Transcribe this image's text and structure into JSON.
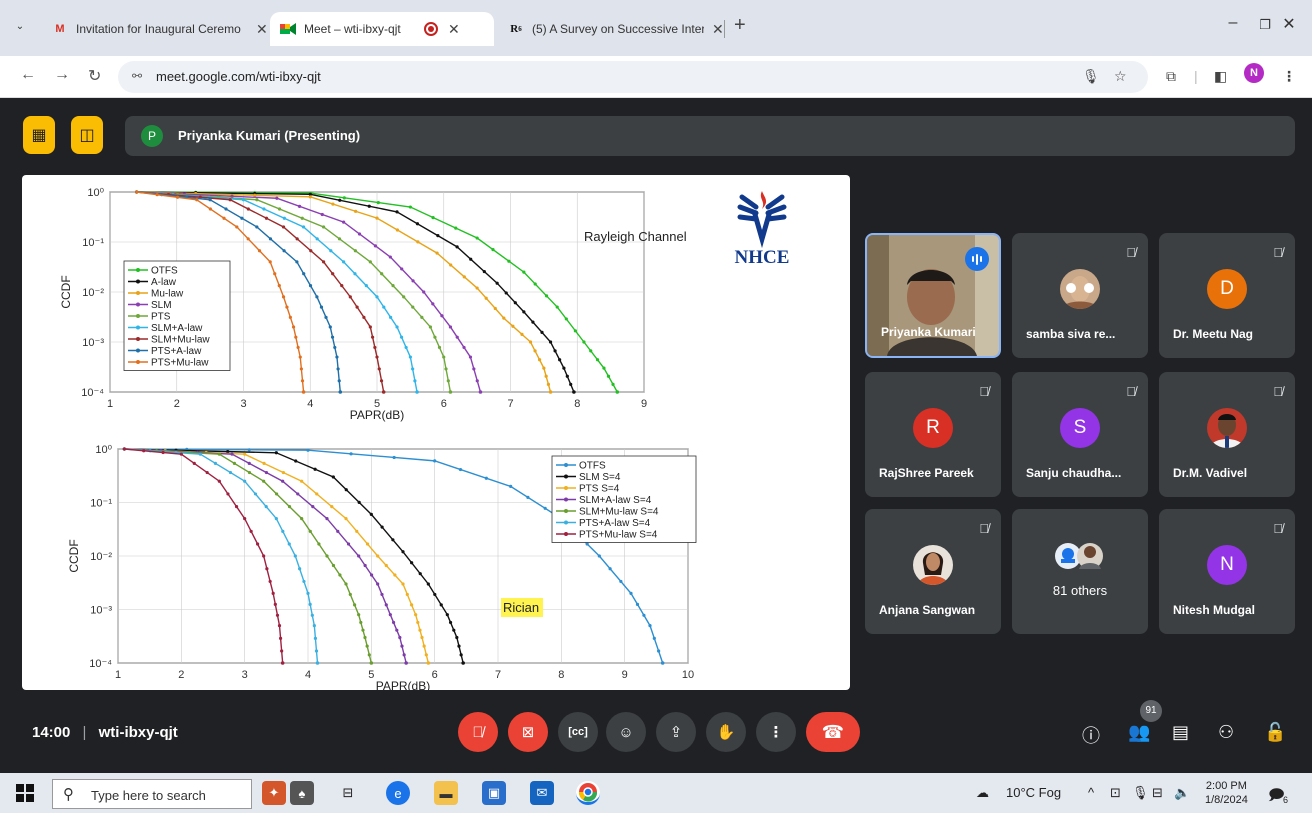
{
  "browser": {
    "tabs": [
      {
        "title": "Invitation for Inaugural Ceremo",
        "icon": "gmail-icon"
      },
      {
        "title": "Meet – wti-ibxy-qjt",
        "icon": "meet-icon",
        "active": true
      },
      {
        "title": "(5) A Survey on Successive Inter",
        "icon": "researchgate-icon"
      }
    ],
    "url": "meet.google.com/wti-ibxy-qjt",
    "profile_initial": "N"
  },
  "meet": {
    "presenter_initial": "P",
    "presenter_label": "Priyanka Kumari (Presenting)",
    "meeting_code": "wti-ibxy-qjt",
    "time": "14:00",
    "participant_count": "91",
    "participants": [
      {
        "name": "Priyanka Kumari",
        "type": "video",
        "speaking": true
      },
      {
        "name": "samba siva re...",
        "type": "photo",
        "muted": true
      },
      {
        "name": "Dr. Meetu Nag",
        "initial": "D",
        "color": "#e8710a",
        "muted": true
      },
      {
        "name": "RajShree Pareek",
        "initial": "R",
        "color": "#d93025",
        "muted": true
      },
      {
        "name": "Sanju chaudha...",
        "initial": "S",
        "color": "#9334e6",
        "muted": true
      },
      {
        "name": "Dr.M. Vadivel",
        "type": "photo",
        "muted": true
      },
      {
        "name": "Anjana Sangwan",
        "type": "photo",
        "muted": true
      },
      {
        "name": "81 others",
        "type": "others"
      },
      {
        "name": "Nitesh Mudgal",
        "initial": "N",
        "color": "#9334e6",
        "muted": true
      }
    ]
  },
  "slide": {
    "logo_text": "NHCE",
    "chart_data": [
      {
        "type": "line",
        "title": "Rayleigh Channel",
        "xlabel": "PAPR(dB)",
        "ylabel": "CCDF",
        "xlim": [
          1,
          9
        ],
        "ylim": [
          0.0001,
          1
        ],
        "yscale": "log",
        "x_ticks": [
          "1",
          "2",
          "3",
          "4",
          "5",
          "6",
          "7",
          "8",
          "9"
        ],
        "y_ticks": [
          "10⁰",
          "10⁻¹",
          "10⁻²",
          "10⁻³",
          "10⁻⁴"
        ],
        "legend_position": "left",
        "series": [
          {
            "name": "OTFS",
            "color": "#22c022",
            "x": [
              1.4,
              4.0,
              5.5,
              6.5,
              7.2,
              7.7,
              8.1,
              8.4,
              8.6
            ],
            "y": [
              1,
              0.95,
              0.5,
              0.12,
              0.025,
              0.005,
              0.001,
              0.0003,
              0.0001
            ]
          },
          {
            "name": "A-law",
            "color": "#111111",
            "x": [
              1.4,
              4.0,
              5.3,
              6.2,
              6.8,
              7.2,
              7.6,
              7.8,
              7.95
            ],
            "y": [
              1,
              0.9,
              0.4,
              0.08,
              0.015,
              0.004,
              0.001,
              0.0003,
              0.0001
            ]
          },
          {
            "name": "Mu-law",
            "color": "#e8a317",
            "x": [
              1.4,
              4.0,
              5.0,
              5.9,
              6.5,
              6.9,
              7.3,
              7.5,
              7.6
            ],
            "y": [
              1,
              0.8,
              0.3,
              0.06,
              0.012,
              0.003,
              0.001,
              0.0003,
              0.0001
            ]
          },
          {
            "name": "SLM",
            "color": "#8a3fb3",
            "x": [
              1.4,
              3.5,
              4.5,
              5.2,
              5.7,
              6.1,
              6.4,
              6.55
            ],
            "y": [
              1,
              0.75,
              0.25,
              0.05,
              0.01,
              0.002,
              0.0005,
              0.0001
            ]
          },
          {
            "name": "PTS",
            "color": "#6fa83a",
            "x": [
              1.4,
              3.2,
              4.2,
              4.9,
              5.4,
              5.8,
              6.0,
              6.1
            ],
            "y": [
              1,
              0.7,
              0.2,
              0.04,
              0.008,
              0.002,
              0.0005,
              0.0001
            ]
          },
          {
            "name": "SLM+A-law",
            "color": "#2fb5e8",
            "x": [
              1.4,
              3.0,
              3.9,
              4.5,
              5.0,
              5.3,
              5.5,
              5.6
            ],
            "y": [
              1,
              0.7,
              0.2,
              0.04,
              0.008,
              0.002,
              0.0005,
              0.0001
            ]
          },
          {
            "name": "SLM+Mu-law",
            "color": "#9c2a2a",
            "x": [
              1.4,
              2.8,
              3.6,
              4.2,
              4.6,
              4.9,
              5.0,
              5.1
            ],
            "y": [
              1,
              0.7,
              0.2,
              0.04,
              0.008,
              0.002,
              0.0005,
              0.0001
            ]
          },
          {
            "name": "PTS+A-law",
            "color": "#1f6fa8",
            "x": [
              1.4,
              2.5,
              3.2,
              3.8,
              4.1,
              4.3,
              4.4,
              4.45
            ],
            "y": [
              1,
              0.7,
              0.2,
              0.04,
              0.008,
              0.002,
              0.0005,
              0.0001
            ]
          },
          {
            "name": "PTS+Mu-law",
            "color": "#e07020",
            "x": [
              1.4,
              2.3,
              2.9,
              3.4,
              3.6,
              3.75,
              3.85,
              3.9
            ],
            "y": [
              1,
              0.7,
              0.2,
              0.04,
              0.008,
              0.002,
              0.0005,
              0.0001
            ]
          }
        ]
      },
      {
        "type": "line",
        "title": "Rician",
        "xlabel": "PAPR(dB)",
        "ylabel": "CCDF",
        "xlim": [
          1,
          10
        ],
        "ylim": [
          0.0001,
          1
        ],
        "yscale": "log",
        "x_ticks": [
          "1",
          "2",
          "3",
          "4",
          "5",
          "6",
          "7",
          "8",
          "9",
          "10"
        ],
        "y_ticks": [
          "10⁰",
          "10⁻¹",
          "10⁻²",
          "10⁻³",
          "10⁻⁴"
        ],
        "legend_position": "top-right",
        "series": [
          {
            "name": "OTFS",
            "color": "#2c8fd1",
            "x": [
              1.1,
              4.0,
              6.0,
              7.2,
              8.0,
              8.6,
              9.1,
              9.4,
              9.6
            ],
            "y": [
              1,
              0.95,
              0.6,
              0.2,
              0.05,
              0.01,
              0.002,
              0.0005,
              0.0001
            ]
          },
          {
            "name": "SLM S=4",
            "color": "#111111",
            "x": [
              1.1,
              3.5,
              4.4,
              5.0,
              5.5,
              5.9,
              6.2,
              6.35,
              6.45
            ],
            "y": [
              1,
              0.85,
              0.3,
              0.06,
              0.012,
              0.003,
              0.0008,
              0.0003,
              0.0001
            ]
          },
          {
            "name": "PTS S=4",
            "color": "#f0b020",
            "x": [
              1.1,
              3.0,
              3.9,
              4.6,
              5.1,
              5.5,
              5.7,
              5.8,
              5.9
            ],
            "y": [
              1,
              0.8,
              0.25,
              0.05,
              0.01,
              0.003,
              0.0008,
              0.0003,
              0.0001
            ]
          },
          {
            "name": "SLM+A-law S=4",
            "color": "#7d3ca8",
            "x": [
              1.1,
              2.8,
              3.6,
              4.3,
              4.8,
              5.1,
              5.3,
              5.45,
              5.55
            ],
            "y": [
              1,
              0.8,
              0.25,
              0.05,
              0.01,
              0.003,
              0.0008,
              0.0003,
              0.0001
            ]
          },
          {
            "name": "SLM+Mu-law S=4",
            "color": "#6a9e2f",
            "x": [
              1.1,
              2.6,
              3.3,
              3.9,
              4.3,
              4.6,
              4.8,
              4.9,
              5.0
            ],
            "y": [
              1,
              0.8,
              0.25,
              0.05,
              0.01,
              0.003,
              0.0008,
              0.0003,
              0.0001
            ]
          },
          {
            "name": "PTS+A-law S=4",
            "color": "#3bb0e0",
            "x": [
              1.1,
              2.3,
              3.0,
              3.5,
              3.8,
              4.0,
              4.1,
              4.15
            ],
            "y": [
              1,
              0.8,
              0.25,
              0.05,
              0.01,
              0.002,
              0.0005,
              0.0001
            ]
          },
          {
            "name": "PTS+Mu-law S=4",
            "color": "#a02040",
            "x": [
              1.1,
              2.0,
              2.6,
              3.0,
              3.3,
              3.45,
              3.55,
              3.6
            ],
            "y": [
              1,
              0.8,
              0.25,
              0.05,
              0.01,
              0.002,
              0.0005,
              0.0001
            ]
          }
        ]
      }
    ]
  },
  "taskbar": {
    "search_placeholder": "Type here to search",
    "weather": "10°C  Fog",
    "time": "2:00 PM",
    "date": "1/8/2024",
    "notifications": "6"
  }
}
